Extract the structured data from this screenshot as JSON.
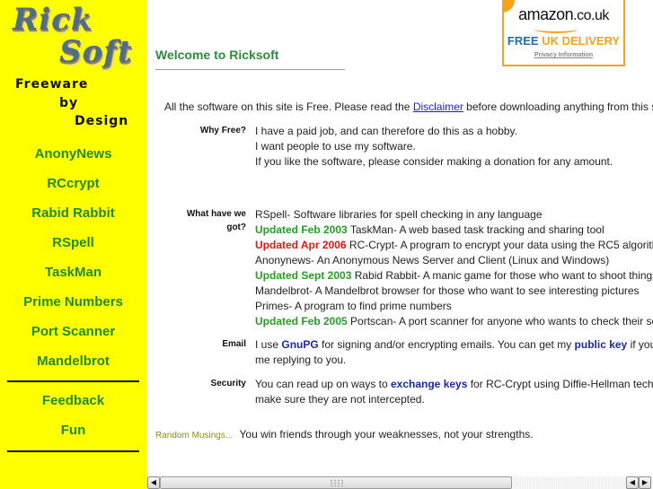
{
  "sidebar": {
    "logo": {
      "line1": "Rick",
      "line2": "Soft"
    },
    "tagline": [
      "Freeware",
      "by",
      "Design"
    ],
    "nav_primary": [
      "AnonyNews",
      "RCcrypt",
      "Rabid Rabbit",
      "RSpell",
      "TaskMan",
      "Prime Numbers",
      "Port Scanner",
      "Mandelbrot"
    ],
    "nav_secondary": [
      "Feedback",
      "Fun"
    ]
  },
  "header": {
    "title": "Welcome to Ricksoft"
  },
  "ad": {
    "brand": "amazon",
    "domain": ".co.uk",
    "free": "FREE",
    "delivery": "UK DELIVERY",
    "privacy": "Privacy Information"
  },
  "intro": {
    "before": "All the software on this site is Free. Please read the ",
    "link": "Disclaimer",
    "after": " before downloading anything from this s"
  },
  "sections": {
    "why": {
      "label": "Why Free?",
      "lines": [
        "I have a paid job, and can therefore do this as a hobby.",
        "I want people to use my software.",
        "If you like the software, please consider making a donation for any amount."
      ]
    },
    "what": {
      "label": "What have we got?",
      "items": [
        {
          "badge": "",
          "text": "RSpell- Software libraries for spell checking in any language"
        },
        {
          "badge": "Updated Feb 2003",
          "badge_color": "green",
          "text": " TaskMan- A web based task tracking and sharing tool"
        },
        {
          "badge": "Updated Apr 2006",
          "badge_color": "red",
          "text": " RC-Crypt- A program to encrypt your data using the RC5 algorith"
        },
        {
          "badge": "",
          "text": "Anonynews- An Anonymous News Server and Client (Linux and Windows)"
        },
        {
          "badge": "Updated Sept 2003",
          "badge_color": "green",
          "text": " Rabid Rabbit- A manic game for those who want to shoot things"
        },
        {
          "badge": "",
          "text": "Mandelbrot- A Mandelbrot browser for those who want to see interesting pictures"
        },
        {
          "badge": "",
          "text": "Primes- A program to find prime numbers"
        },
        {
          "badge": "Updated Feb 2005",
          "badge_color": "green",
          "text": " Portscan- A port scanner for anyone who wants to check their se"
        }
      ]
    },
    "email": {
      "label": "Email",
      "p1": "I use ",
      "link1": "GnuPG",
      "p2": " for signing and/or encrypting emails. You can get my ",
      "link2": "public key",
      "p3": " if you",
      "line2": "me replying to you."
    },
    "security": {
      "label": "Security",
      "p1": "You can read up on ways to ",
      "link": "exchange keys",
      "p2": " for RC-Crypt using Diffie-Hellman techn",
      "line2": "make sure they are not intercepted."
    }
  },
  "musings": {
    "label": "Random Musings...",
    "text": "You win friends through your weaknesses, not your strengths."
  },
  "scrollbar": {
    "left_arrow": "◀",
    "right_arrow": "▶"
  },
  "colors": {
    "sidebar_bg": "#ffff00",
    "nav_green": "#228b22",
    "updated_green": "#23a023",
    "updated_red": "#ee1111",
    "link_blue": "#1a2aa0",
    "amazon_orange": "#f7a21e"
  }
}
